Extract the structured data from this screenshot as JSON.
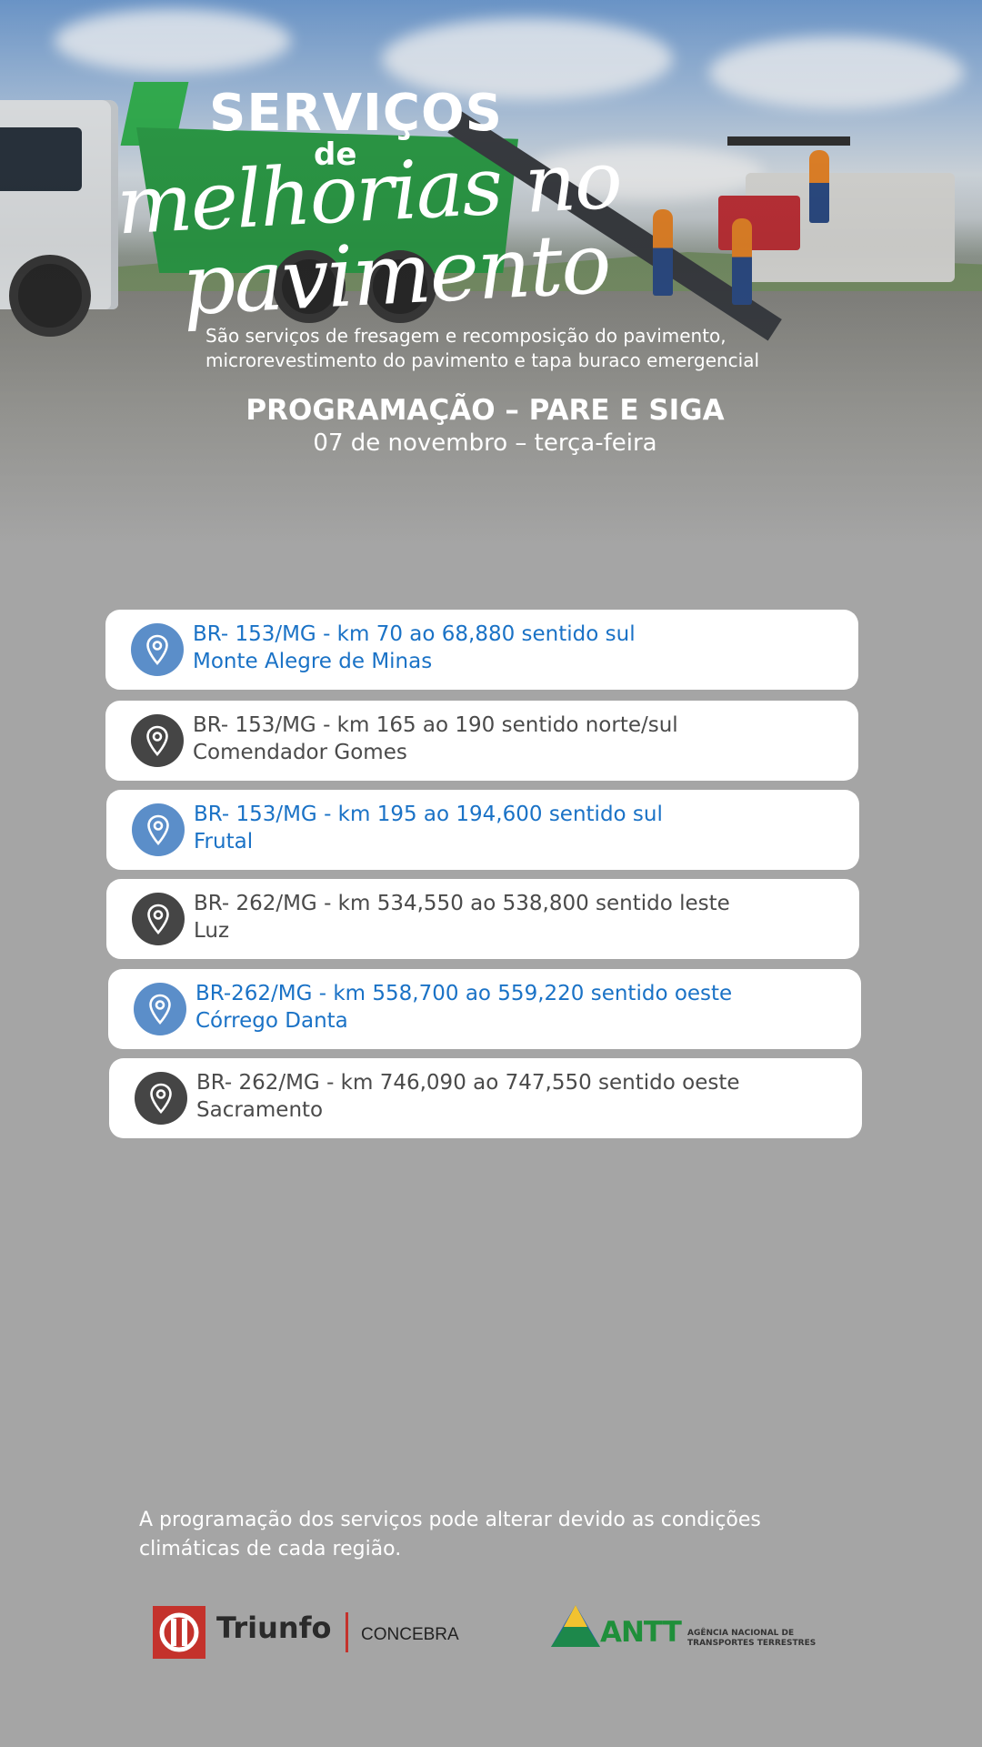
{
  "hero": {
    "title_line1": "SERVIÇOS",
    "title_line2": "de",
    "title_line3": "melhorias no",
    "title_line4": "pavimento",
    "description_line1": "São serviços de fresagem  e recomposição do pavimento,",
    "description_line2": "microrevestimento do pavimento  e tapa buraco emergencial",
    "schedule_title": "PROGRAMAÇÃO – PARE E SIGA",
    "schedule_date": "07 de novembro – terça-feira"
  },
  "colors": {
    "blue": "#1a72c6",
    "gray_text": "#4a4a4a",
    "pin_blue": "#5b8ec9",
    "pin_dark": "#454545",
    "background": "#a5a5a5"
  },
  "locations": [
    {
      "line1": "BR- 153/MG - km 70 ao 68,880 sentido sul",
      "line2": "Monte Alegre de Minas",
      "style": "blue",
      "icon": "location-pin-icon"
    },
    {
      "line1": "BR- 153/MG -  km 165 ao 190 sentido norte/sul",
      "line2": "Comendador Gomes",
      "style": "dark",
      "icon": "location-pin-icon"
    },
    {
      "line1": "BR- 153/MG - km 195 ao 194,600 sentido sul",
      "line2": "Frutal",
      "style": "blue",
      "icon": "location-pin-icon"
    },
    {
      "line1": "BR- 262/MG - km 534,550 ao 538,800 sentido leste",
      "line2": "Luz",
      "style": "dark",
      "icon": "location-pin-icon"
    },
    {
      "line1": "BR-262/MG - km 558,700 ao 559,220 sentido oeste",
      "line2": "Córrego Danta",
      "style": "blue",
      "icon": "location-pin-icon"
    },
    {
      "line1": "BR- 262/MG - km 746,090 ao 747,550 sentido oeste",
      "line2": "Sacramento",
      "style": "dark",
      "icon": "location-pin-icon"
    }
  ],
  "footer": {
    "notice_line1": "A programação dos serviços pode alterar devido as condições",
    "notice_line2": "climáticas de cada região.",
    "logo_triunfo": "Triunfo",
    "logo_concebra": "CONCEBRA",
    "logo_antt": "ANTT",
    "antt_sub_line1": "AGÊNCIA NACIONAL DE",
    "antt_sub_line2": "TRANSPORTES TERRESTRES"
  }
}
